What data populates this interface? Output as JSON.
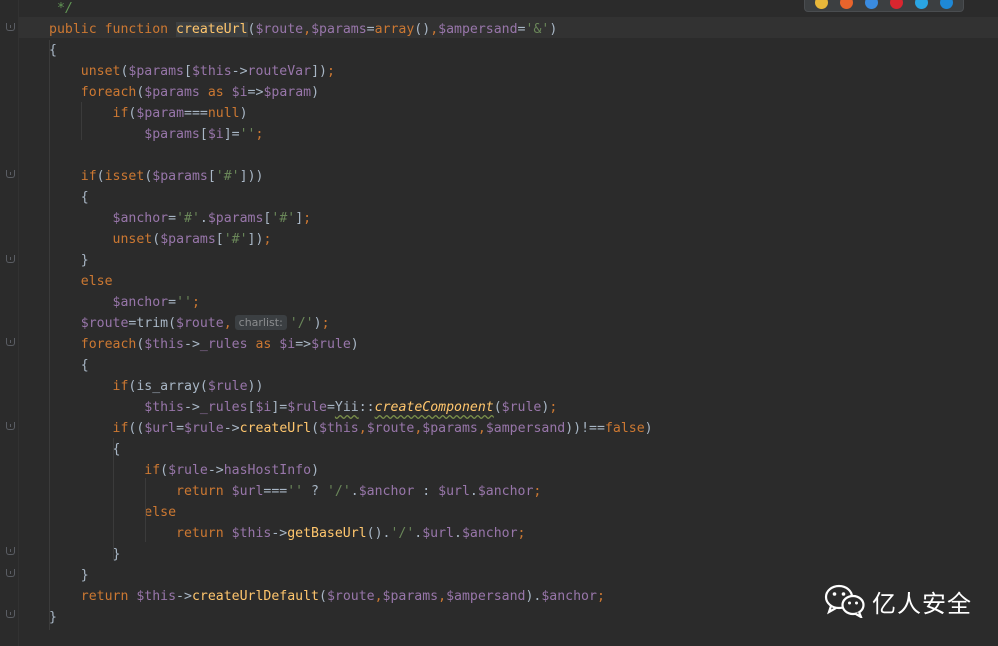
{
  "editor": {
    "lines": [
      [
        [
          "cm",
          "*/"
        ]
      ],
      [
        [
          "kw",
          "public "
        ],
        [
          "kw",
          "function "
        ],
        [
          "fnhl",
          "createUrl"
        ],
        [
          "t",
          "("
        ],
        [
          "var",
          "$route"
        ],
        [
          "kw",
          ","
        ],
        [
          "var",
          "$params"
        ],
        [
          "t",
          "="
        ],
        [
          "kw",
          "array"
        ],
        [
          "t",
          "()"
        ],
        [
          "kw",
          ","
        ],
        [
          "var",
          "$ampersand"
        ],
        [
          "t",
          "="
        ],
        [
          "str",
          "'&'"
        ],
        [
          "t",
          ")"
        ]
      ],
      [
        [
          "t",
          "{"
        ]
      ],
      [
        [
          "t",
          "    "
        ],
        [
          "kw",
          "unset"
        ],
        [
          "t",
          "("
        ],
        [
          "var",
          "$params"
        ],
        [
          "t",
          "["
        ],
        [
          "var",
          "$this"
        ],
        [
          "t",
          "->"
        ],
        [
          "var",
          "routeVar"
        ],
        [
          "t",
          "])"
        ],
        [
          "kw",
          ";"
        ]
      ],
      [
        [
          "t",
          "    "
        ],
        [
          "kw",
          "foreach"
        ],
        [
          "t",
          "("
        ],
        [
          "var",
          "$params "
        ],
        [
          "kw",
          "as "
        ],
        [
          "var",
          "$i"
        ],
        [
          "t",
          "=>"
        ],
        [
          "var",
          "$param"
        ],
        [
          "t",
          ")"
        ]
      ],
      [
        [
          "t",
          "        "
        ],
        [
          "kw",
          "if"
        ],
        [
          "t",
          "("
        ],
        [
          "var",
          "$param"
        ],
        [
          "t",
          "==="
        ],
        [
          "kw",
          "null"
        ],
        [
          "t",
          ")"
        ]
      ],
      [
        [
          "t",
          "            "
        ],
        [
          "var",
          "$params"
        ],
        [
          "t",
          "["
        ],
        [
          "var",
          "$i"
        ],
        [
          "t",
          "]="
        ],
        [
          "str",
          "''"
        ],
        [
          "kw",
          ";"
        ]
      ],
      [
        [
          "t",
          ""
        ]
      ],
      [
        [
          "t",
          "    "
        ],
        [
          "kw",
          "if"
        ],
        [
          "t",
          "("
        ],
        [
          "kw",
          "isset"
        ],
        [
          "t",
          "("
        ],
        [
          "var",
          "$params"
        ],
        [
          "t",
          "["
        ],
        [
          "str",
          "'#'"
        ],
        [
          "t",
          "]))"
        ]
      ],
      [
        [
          "t",
          "    {"
        ]
      ],
      [
        [
          "t",
          "        "
        ],
        [
          "var",
          "$anchor"
        ],
        [
          "t",
          "="
        ],
        [
          "str",
          "'#'"
        ],
        [
          "t",
          "."
        ],
        [
          "var",
          "$params"
        ],
        [
          "t",
          "["
        ],
        [
          "str",
          "'#'"
        ],
        [
          "t",
          "]"
        ],
        [
          "kw",
          ";"
        ]
      ],
      [
        [
          "t",
          "        "
        ],
        [
          "kw",
          "unset"
        ],
        [
          "t",
          "("
        ],
        [
          "var",
          "$params"
        ],
        [
          "t",
          "["
        ],
        [
          "str",
          "'#'"
        ],
        [
          "t",
          "])"
        ],
        [
          "kw",
          ";"
        ]
      ],
      [
        [
          "t",
          "    }"
        ]
      ],
      [
        [
          "t",
          "    "
        ],
        [
          "kw",
          "else"
        ]
      ],
      [
        [
          "t",
          "        "
        ],
        [
          "var",
          "$anchor"
        ],
        [
          "t",
          "="
        ],
        [
          "str",
          "''"
        ],
        [
          "kw",
          ";"
        ]
      ],
      [
        [
          "t",
          "    "
        ],
        [
          "var",
          "$route"
        ],
        [
          "t",
          "=trim("
        ],
        [
          "var",
          "$route"
        ],
        [
          "kw",
          ","
        ],
        [
          "hint",
          "charlist:"
        ],
        [
          "str",
          "'/'"
        ],
        [
          "t",
          ")"
        ],
        [
          "kw",
          ";"
        ]
      ],
      [
        [
          "t",
          "    "
        ],
        [
          "kw",
          "foreach"
        ],
        [
          "t",
          "("
        ],
        [
          "var",
          "$this"
        ],
        [
          "t",
          "->"
        ],
        [
          "var",
          "_rules "
        ],
        [
          "kw",
          "as "
        ],
        [
          "var",
          "$i"
        ],
        [
          "t",
          "=>"
        ],
        [
          "var",
          "$rule"
        ],
        [
          "t",
          ")"
        ]
      ],
      [
        [
          "t",
          "    {"
        ]
      ],
      [
        [
          "t",
          "        "
        ],
        [
          "kw",
          "if"
        ],
        [
          "t",
          "(is_array("
        ],
        [
          "var",
          "$rule"
        ],
        [
          "t",
          "))"
        ]
      ],
      [
        [
          "t",
          "            "
        ],
        [
          "var",
          "$this"
        ],
        [
          "t",
          "->"
        ],
        [
          "var",
          "_rules"
        ],
        [
          "t",
          "["
        ],
        [
          "var",
          "$i"
        ],
        [
          "t",
          "]="
        ],
        [
          "var",
          "$rule"
        ],
        [
          "t",
          "="
        ],
        [
          "wavy",
          "Yii"
        ],
        [
          "t",
          "::"
        ],
        [
          "fnit",
          "createComponent"
        ],
        [
          "t",
          "("
        ],
        [
          "var",
          "$rule"
        ],
        [
          "t",
          ")"
        ],
        [
          "kw",
          ";"
        ]
      ],
      [
        [
          "t",
          "        "
        ],
        [
          "kw",
          "if"
        ],
        [
          "t",
          "(("
        ],
        [
          "var",
          "$url"
        ],
        [
          "t",
          "="
        ],
        [
          "var",
          "$rule"
        ],
        [
          "t",
          "->"
        ],
        [
          "fn",
          "createUrl"
        ],
        [
          "t",
          "("
        ],
        [
          "var",
          "$this"
        ],
        [
          "kw",
          ","
        ],
        [
          "var",
          "$route"
        ],
        [
          "kw",
          ","
        ],
        [
          "var",
          "$params"
        ],
        [
          "kw",
          ","
        ],
        [
          "var",
          "$ampersand"
        ],
        [
          "t",
          "))!=="
        ],
        [
          "kw",
          "false"
        ],
        [
          "t",
          ")"
        ]
      ],
      [
        [
          "t",
          "        {"
        ]
      ],
      [
        [
          "t",
          "            "
        ],
        [
          "kw",
          "if"
        ],
        [
          "t",
          "("
        ],
        [
          "var",
          "$rule"
        ],
        [
          "t",
          "->"
        ],
        [
          "var",
          "hasHostInfo"
        ],
        [
          "t",
          ")"
        ]
      ],
      [
        [
          "t",
          "                "
        ],
        [
          "kw",
          "return "
        ],
        [
          "var",
          "$url"
        ],
        [
          "t",
          "==="
        ],
        [
          "str",
          "''"
        ],
        [
          "t",
          " ? "
        ],
        [
          "str",
          "'/'"
        ],
        [
          "t",
          "."
        ],
        [
          "var",
          "$anchor"
        ],
        [
          "t",
          " : "
        ],
        [
          "var",
          "$url"
        ],
        [
          "t",
          "."
        ],
        [
          "var",
          "$anchor"
        ],
        [
          "kw",
          ";"
        ]
      ],
      [
        [
          "t",
          "            "
        ],
        [
          "kw",
          "else"
        ]
      ],
      [
        [
          "t",
          "                "
        ],
        [
          "kw",
          "return "
        ],
        [
          "var",
          "$this"
        ],
        [
          "t",
          "->"
        ],
        [
          "fn",
          "getBaseUrl"
        ],
        [
          "t",
          "()."
        ],
        [
          "str",
          "'/'"
        ],
        [
          "t",
          "."
        ],
        [
          "var",
          "$url"
        ],
        [
          "t",
          "."
        ],
        [
          "var",
          "$anchor"
        ],
        [
          "kw",
          ";"
        ]
      ],
      [
        [
          "t",
          "        }"
        ]
      ],
      [
        [
          "t",
          "    }"
        ]
      ],
      [
        [
          "t",
          "    "
        ],
        [
          "kw",
          "return "
        ],
        [
          "var",
          "$this"
        ],
        [
          "t",
          "->"
        ],
        [
          "fn",
          "createUrlDefault"
        ],
        [
          "t",
          "("
        ],
        [
          "var",
          "$route"
        ],
        [
          "kw",
          ","
        ],
        [
          "var",
          "$params"
        ],
        [
          "kw",
          ","
        ],
        [
          "var",
          "$ampersand"
        ],
        [
          "t",
          ")."
        ],
        [
          "var",
          "$anchor"
        ],
        [
          "kw",
          ";"
        ]
      ],
      [
        [
          "t",
          "}"
        ]
      ]
    ]
  },
  "browser_icons": [
    {
      "name": "chrome-icon",
      "color": "#e8b73a"
    },
    {
      "name": "firefox-icon",
      "color": "#e8642c"
    },
    {
      "name": "safari-icon",
      "color": "#3a8be0"
    },
    {
      "name": "opera-icon",
      "color": "#d9262f"
    },
    {
      "name": "ie-icon",
      "color": "#2aa5e3"
    },
    {
      "name": "edge-icon",
      "color": "#1e88d6"
    }
  ],
  "watermark": {
    "text": "亿人安全",
    "icon": "wechat-icon"
  }
}
